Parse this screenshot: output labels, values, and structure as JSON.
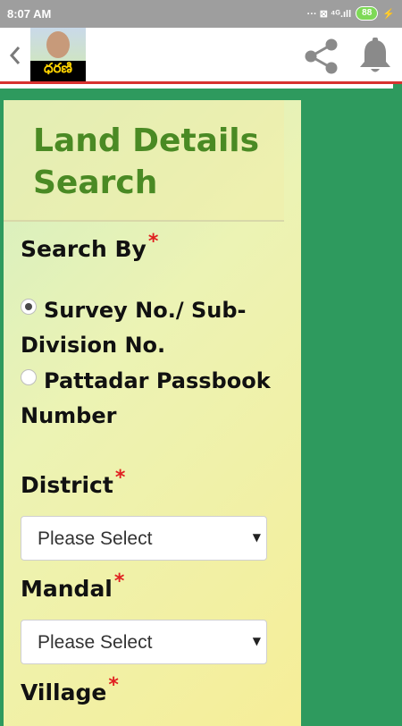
{
  "status_bar": {
    "time": "8:07 AM",
    "indicators": "··· ⊠ ⁴ᴳ.ıll",
    "battery": "88"
  },
  "app_bar": {
    "logo_text": "ధరణి",
    "icons": [
      "back-icon",
      "share-icon",
      "bell-icon"
    ]
  },
  "card": {
    "title": "Land Details Search",
    "search_by_label": "Search By",
    "required_mark": "*",
    "options": [
      {
        "label": "Survey No./ Sub-Division No.",
        "checked": true
      },
      {
        "label": "Pattadar Passbook Number",
        "checked": false
      }
    ],
    "district_label": "District",
    "district_value": "Please Select",
    "mandal_label": "Mandal",
    "mandal_value": "Please Select",
    "village_label": "Village"
  },
  "colors": {
    "background": "#2e9a5e",
    "title": "#4a8a24",
    "required": "#e02020",
    "accent_line": "#d8322f"
  }
}
